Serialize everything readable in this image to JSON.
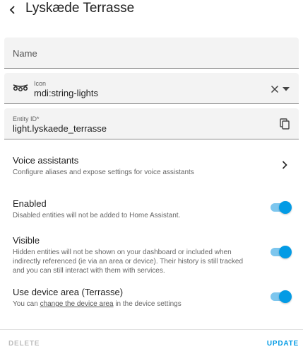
{
  "header": {
    "title": "Lyskæde Terrasse"
  },
  "name_field": {
    "placeholder": "Name"
  },
  "icon_field": {
    "label": "Icon",
    "value": "mdi:string-lights"
  },
  "entity_field": {
    "label": "Entity ID*",
    "value": "light.lyskaede_terrasse"
  },
  "voice": {
    "title": "Voice assistants",
    "description": "Configure aliases and expose settings for voice assistants"
  },
  "enabled": {
    "title": "Enabled",
    "description": "Disabled entities will not be added to Home Assistant.",
    "on": true
  },
  "visible": {
    "title": "Visible",
    "description_1": "Hidden entities will not be shown on your dashboard or included when",
    "description_2": "indirectly referenced (ie via an area or device). Their history is still tracked",
    "description_3": "and you can still interact with them with services.",
    "on": true
  },
  "device_area": {
    "title": "Use device area (Terrasse)",
    "description_prefix": "You can",
    "description_link": "change the device area",
    "description_suffix": "in the device settings",
    "on": true
  },
  "footer": {
    "delete_label": "DELETE",
    "update_label": "UPDATE"
  },
  "colors": {
    "accent": "#039be5",
    "track": "#7dc6ee",
    "field_bg": "#f3f3f3"
  }
}
